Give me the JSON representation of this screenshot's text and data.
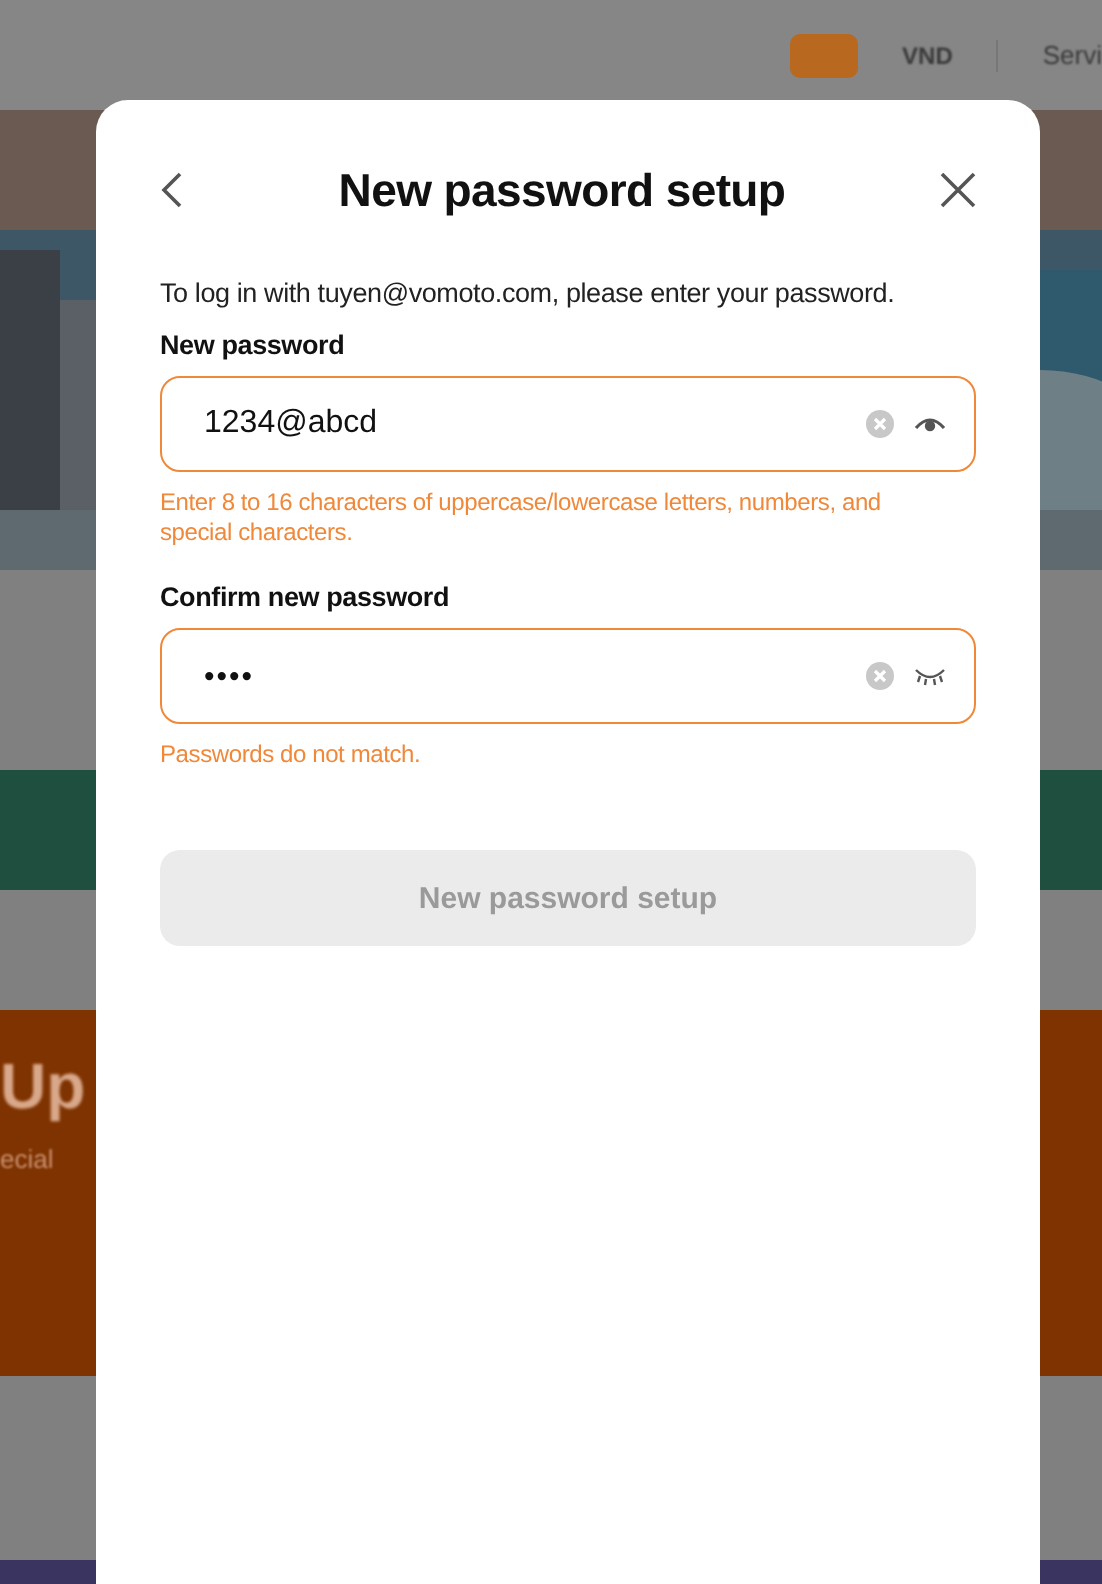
{
  "background": {
    "currency": "VND",
    "nav_item": "Servi",
    "banner_title": "Up",
    "banner_subtitle": "ecial"
  },
  "dialog": {
    "title": "New password setup",
    "intro": "To log in with tuyen@vomoto.com, please enter your password.",
    "fields": [
      {
        "label": "New password",
        "value": "1234@abcd",
        "password_visible": true,
        "error": "Enter 8 to 16 characters of uppercase/lowercase letters, numbers, and special characters."
      },
      {
        "label": "Confirm new password",
        "value": "••••",
        "password_visible": false,
        "error": "Passwords do not match."
      }
    ],
    "submit": {
      "label": "New password setup",
      "disabled": true
    }
  }
}
